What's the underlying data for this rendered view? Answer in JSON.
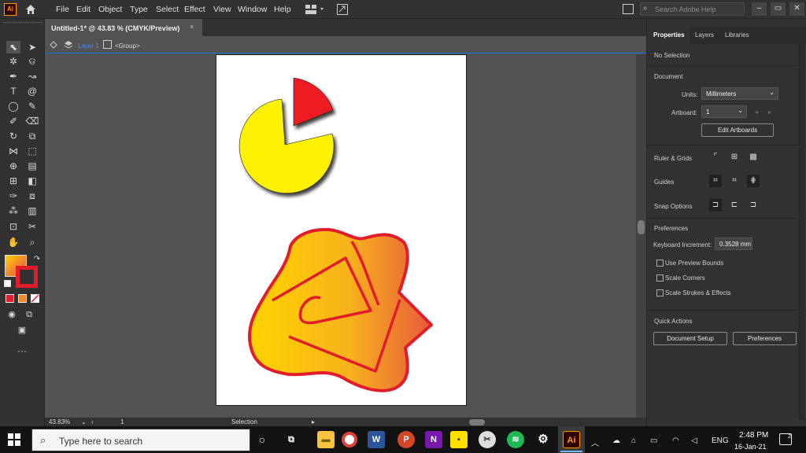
{
  "app": {
    "logo": "Ai",
    "home_icon": "home-icon"
  },
  "menu": [
    "File",
    "Edit",
    "Object",
    "Type",
    "Select",
    "Effect",
    "View",
    "Window",
    "Help"
  ],
  "search": {
    "placeholder": "Search Adobe Help"
  },
  "window_controls": {
    "minimize": "–",
    "restore": "▭",
    "close": "✕"
  },
  "document": {
    "tab_title": "Untitled-1* @ 43.83 % (CMYK/Preview)",
    "close": "×"
  },
  "breadcrumb": {
    "layer": "Layer 1",
    "group": "<Group>"
  },
  "status": {
    "zoom": "43.83%",
    "artboard": "1",
    "tool": "Selection"
  },
  "panel": {
    "tabs": [
      "Properties",
      "Layers",
      "Libraries"
    ],
    "selection": "No Selection",
    "document_title": "Document",
    "units_label": "Units:",
    "units_value": "Millimeters",
    "artboard_label": "Artboard:",
    "artboard_value": "1",
    "edit_artboards": "Edit Artboards",
    "ruler_grids": "Ruler & Grids",
    "guides": "Guides",
    "snap_options": "Snap Options",
    "preferences_title": "Preferences",
    "keyboard_increment_label": "Keyboard Increment:",
    "keyboard_increment_value": "0.3528 mm",
    "checkboxes": [
      "Use Preview Bounds",
      "Scale Corners",
      "Scale Strokes & Effects"
    ],
    "quick_actions": "Quick Actions",
    "document_setup": "Document Setup",
    "preferences_btn": "Preferences"
  },
  "colors": {
    "fill_gradient_start": "#ffd400",
    "fill_gradient_end": "#e85a3c",
    "stroke": "#e11d2c",
    "pie_yellow": "#fff200",
    "pie_red": "#ed1c24",
    "accent": "#1473e6"
  },
  "taskbar": {
    "search_placeholder": "Type here to search",
    "time": "2:48 PM",
    "date": "16-Jan-21",
    "lang": "ENG",
    "notifications": "2",
    "apps": [
      "File Explorer",
      "Chrome",
      "Word",
      "PowerPoint",
      "OneNote",
      "Sticky Notes",
      "Snipping",
      "Spotify",
      "Settings",
      "Illustrator"
    ]
  }
}
